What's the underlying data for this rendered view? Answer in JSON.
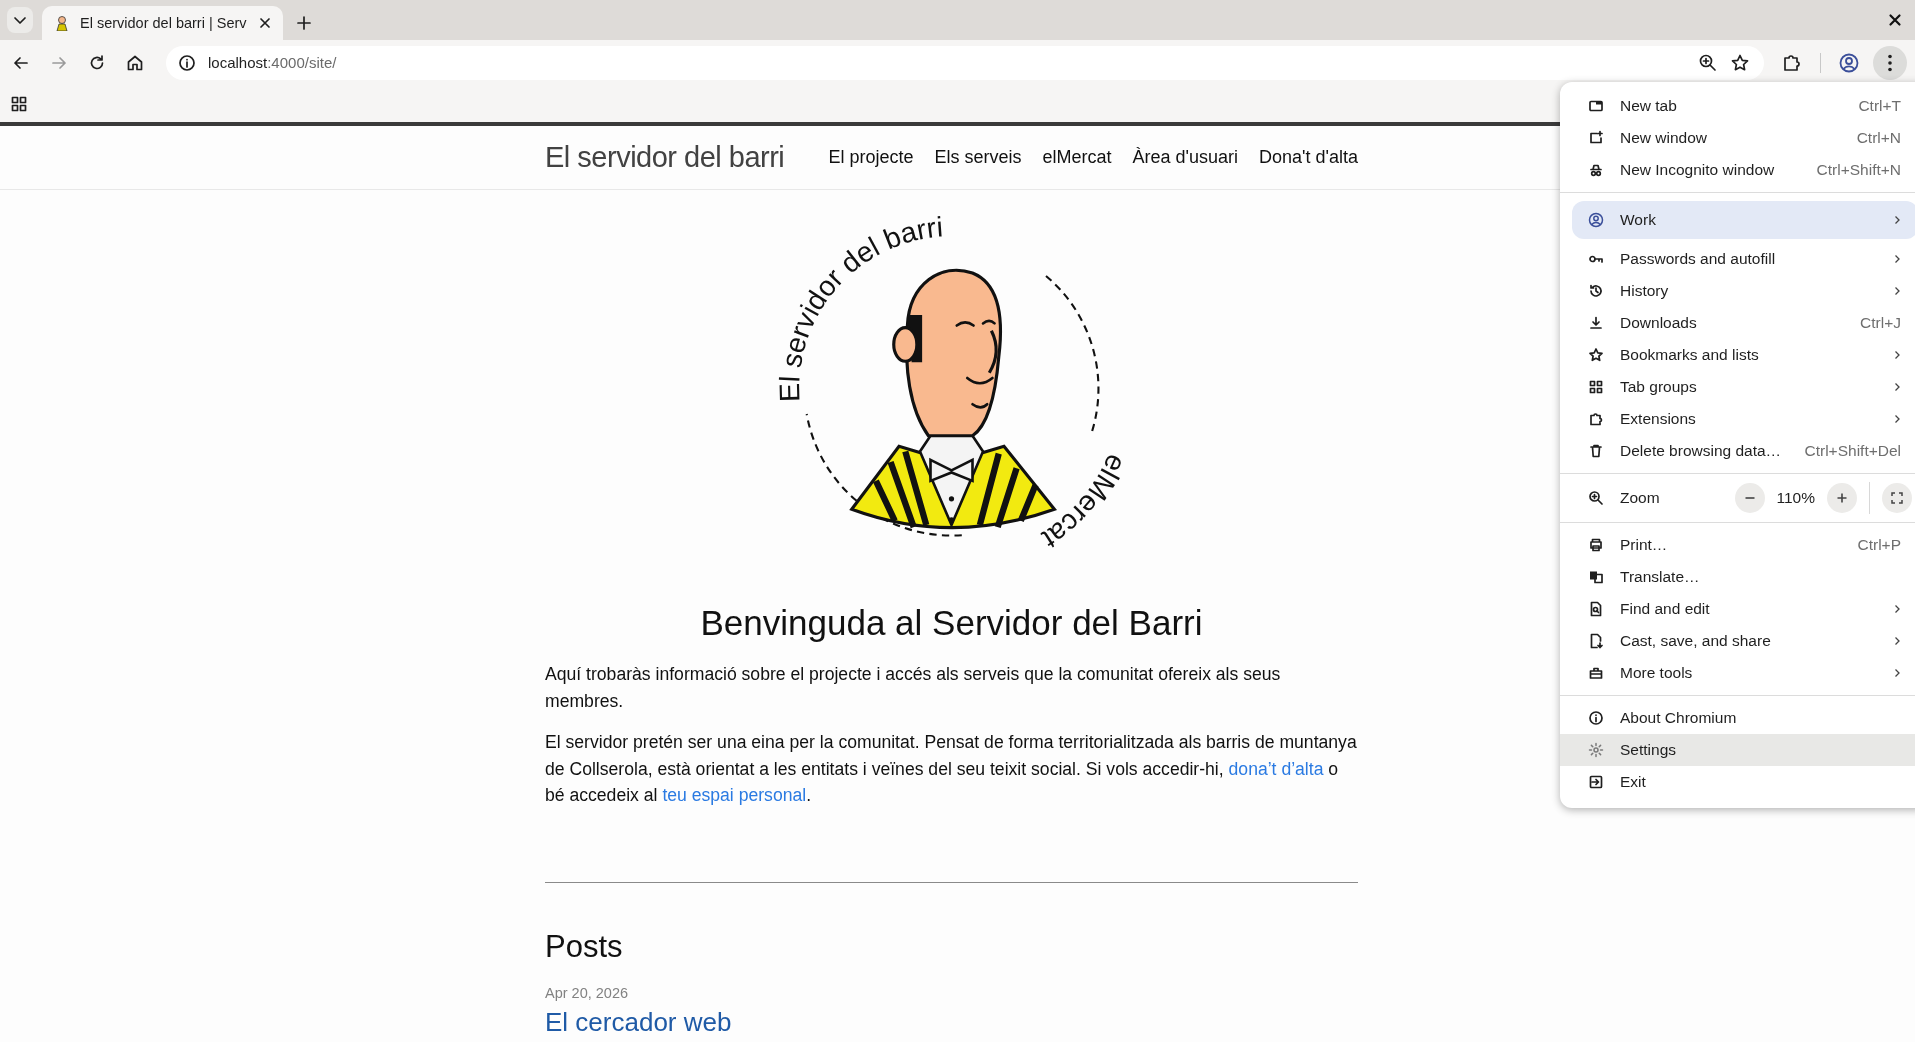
{
  "browser": {
    "tab": {
      "title": "El servidor del barri | Serv",
      "selected": true
    },
    "address": {
      "host": "localhost",
      "path": ":4000/site/"
    }
  },
  "site": {
    "title": "El servidor del barri",
    "nav": [
      {
        "label": "El projecte"
      },
      {
        "label": "Els serveis"
      },
      {
        "label": "elMercat"
      },
      {
        "label": "Àrea d'usuari"
      },
      {
        "label": "Dona't d'alta"
      }
    ],
    "logo": {
      "top_text": "El servidor del barri",
      "bottom_text": "elMercat"
    },
    "heading": "Benvinguda al Servidor del Barri",
    "paragraphs": [
      {
        "parts": [
          {
            "kind": "text",
            "text": "Aquí trobaràs informació sobre el projecte i accés als serveis que la comunitat ofereix als seus membres."
          }
        ]
      },
      {
        "parts": [
          {
            "kind": "text",
            "text": "El servidor pretén ser una eina per la comunitat. Pensat de forma territorialitzada als barris de muntanya de Collserola, està orientat a les entitats i veïnes del seu teixit social. Si vols accedir-hi, "
          },
          {
            "kind": "link",
            "text": "dona’t d’alta"
          },
          {
            "kind": "text",
            "text": " o bé accedeix al "
          },
          {
            "kind": "link",
            "text": "teu espai personal"
          },
          {
            "kind": "text",
            "text": "."
          }
        ]
      }
    ],
    "posts": {
      "heading": "Posts",
      "items": [
        {
          "date": "Apr 20, 2026",
          "title": "El cercador web"
        }
      ]
    }
  },
  "menu": {
    "groups": [
      {
        "items": [
          {
            "kind": "command",
            "label": "New tab",
            "shortcut": "Ctrl+T",
            "submenu": false,
            "highlighted": false
          },
          {
            "kind": "command",
            "label": "New window",
            "shortcut": "Ctrl+N",
            "submenu": false,
            "highlighted": false
          },
          {
            "kind": "command",
            "label": "New Incognito window",
            "shortcut": "Ctrl+Shift+N",
            "submenu": false,
            "highlighted": false
          }
        ]
      },
      {
        "items": [
          {
            "kind": "profile",
            "label": "Work",
            "submenu": true,
            "highlighted": false
          },
          {
            "kind": "command",
            "label": "Passwords and autofill",
            "submenu": true,
            "highlighted": false
          },
          {
            "kind": "command",
            "label": "History",
            "submenu": true,
            "highlighted": false
          },
          {
            "kind": "command",
            "label": "Downloads",
            "shortcut": "Ctrl+J",
            "submenu": false,
            "highlighted": false
          },
          {
            "kind": "command",
            "label": "Bookmarks and lists",
            "submenu": true,
            "highlighted": false
          },
          {
            "kind": "command",
            "label": "Tab groups",
            "submenu": true,
            "highlighted": false
          },
          {
            "kind": "command",
            "label": "Extensions",
            "submenu": true,
            "highlighted": false
          },
          {
            "kind": "command",
            "label": "Delete browsing data…",
            "shortcut": "Ctrl+Shift+Del",
            "submenu": false,
            "highlighted": false
          }
        ]
      },
      {
        "items": [
          {
            "kind": "zoom",
            "label": "Zoom",
            "value": "110%"
          }
        ]
      },
      {
        "items": [
          {
            "kind": "command",
            "label": "Print…",
            "shortcut": "Ctrl+P",
            "submenu": false,
            "highlighted": false
          },
          {
            "kind": "command",
            "label": "Translate…",
            "submenu": false,
            "highlighted": false
          },
          {
            "kind": "command",
            "label": "Find and edit",
            "submenu": true,
            "highlighted": false
          },
          {
            "kind": "command",
            "label": "Cast, save, and share",
            "submenu": true,
            "highlighted": false
          },
          {
            "kind": "command",
            "label": "More tools",
            "submenu": true,
            "highlighted": false
          }
        ]
      },
      {
        "items": [
          {
            "kind": "command",
            "label": "About Chromium",
            "submenu": false,
            "highlighted": false
          },
          {
            "kind": "command",
            "label": "Settings",
            "submenu": false,
            "highlighted": true
          },
          {
            "kind": "command",
            "label": "Exit",
            "submenu": false,
            "highlighted": false
          }
        ]
      }
    ]
  }
}
